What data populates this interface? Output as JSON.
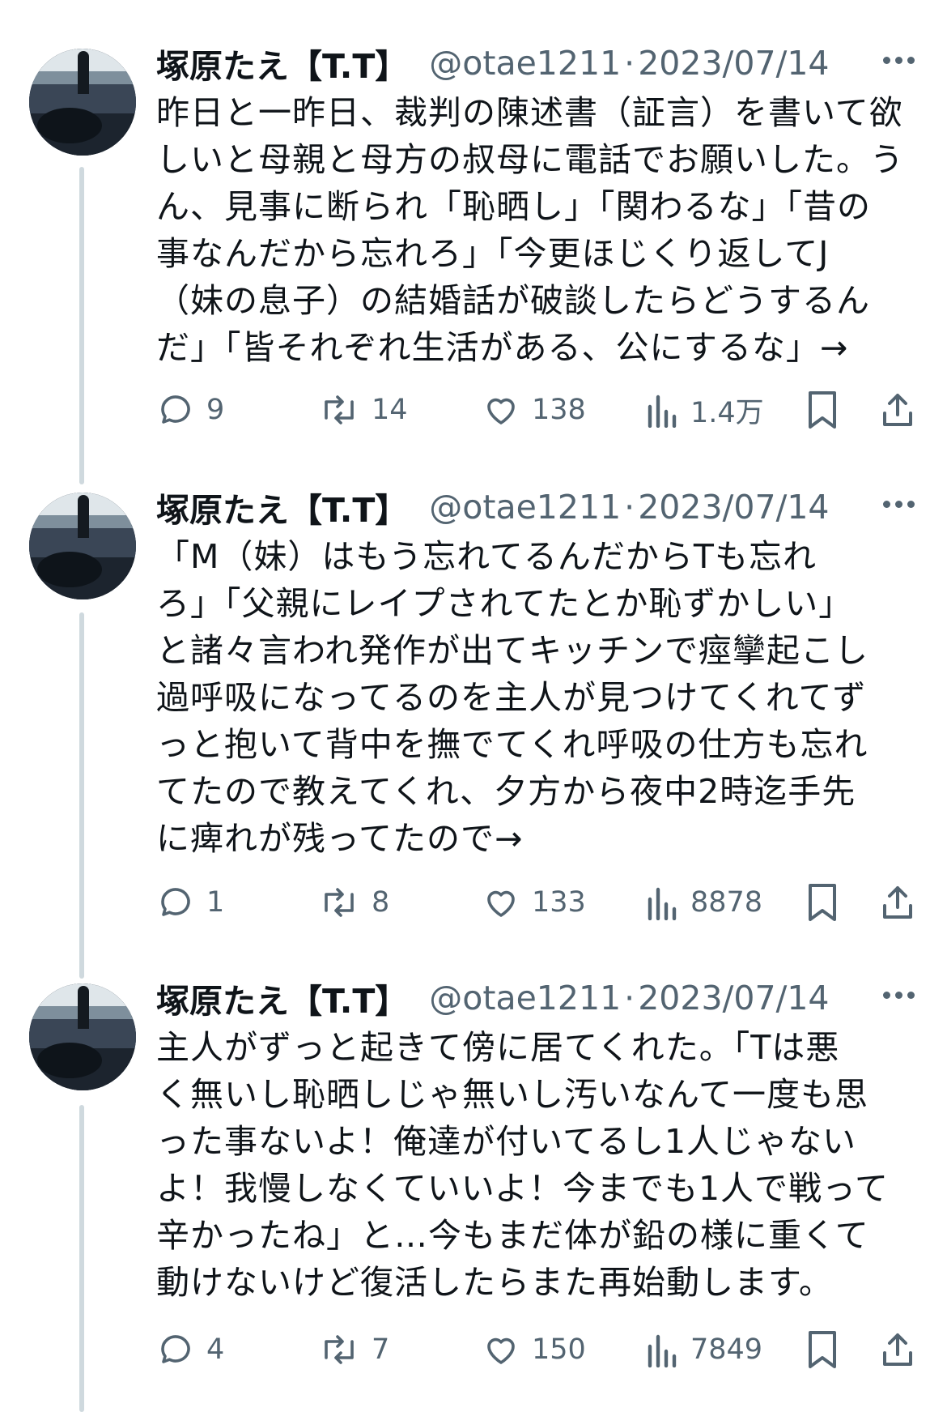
{
  "tweets": [
    {
      "name": "塚原たえ【T.T】",
      "handle": "@otae1211",
      "separator": "·",
      "date": "2023/07/14",
      "lines": [
        "昨日と一昨日、裁判の陳述書（証言）を書いて欲",
        "しいと母親と母方の叔母に電話でお願いした。う",
        "ん、見事に断られ「恥晒し」「関わるな」「昔の",
        "事なんだから忘れろ」「今更ほじくり返してJ",
        "（妹の息子）の結婚話が破談したらどうするん",
        "だ」「皆それぞれ生活がある、公にするな」→"
      ],
      "replies": "9",
      "retweets": "14",
      "likes": "138",
      "views": "1.4万"
    },
    {
      "name": "塚原たえ【T.T】",
      "handle": "@otae1211",
      "separator": "·",
      "date": "2023/07/14",
      "lines": [
        "「M（妹）はもう忘れてるんだからTも忘れ",
        "ろ」「父親にレイプされてたとか恥ずかしい」",
        "と諸々言われ発作が出てキッチンで痙攣起こし",
        "過呼吸になってるのを主人が見つけてくれてず",
        "っと抱いて背中を撫でてくれ呼吸の仕方も忘れ",
        "てたので教えてくれ、夕方から夜中2時迄手先",
        "に痺れが残ってたので→"
      ],
      "replies": "1",
      "retweets": "8",
      "likes": "133",
      "views": "8878"
    },
    {
      "name": "塚原たえ【T.T】",
      "handle": "@otae1211",
      "separator": "·",
      "date": "2023/07/14",
      "lines": [
        "主人がずっと起きて傍に居てくれた。「Tは悪",
        "く無いし恥晒しじゃ無いし汚いなんて一度も思",
        "った事ないよ！俺達が付いてるし1人じゃない",
        "よ！我慢しなくていいよ！今までも1人で戦って",
        "辛かったね」と…今もまだ体が鉛の様に重くて",
        "動けないけど復活したらまた再始動します。"
      ],
      "replies": "4",
      "retweets": "7",
      "likes": "150",
      "views": "7849"
    }
  ],
  "icons": {
    "reply": "reply-icon",
    "retweet": "retweet-icon",
    "like": "heart-icon",
    "views": "views-chart-icon",
    "bookmark": "bookmark-icon",
    "share": "share-icon",
    "more": "more-dots-icon"
  },
  "colors": {
    "text": "#0f1419",
    "secondary": "#536471",
    "thread_line": "#cfd9de"
  }
}
